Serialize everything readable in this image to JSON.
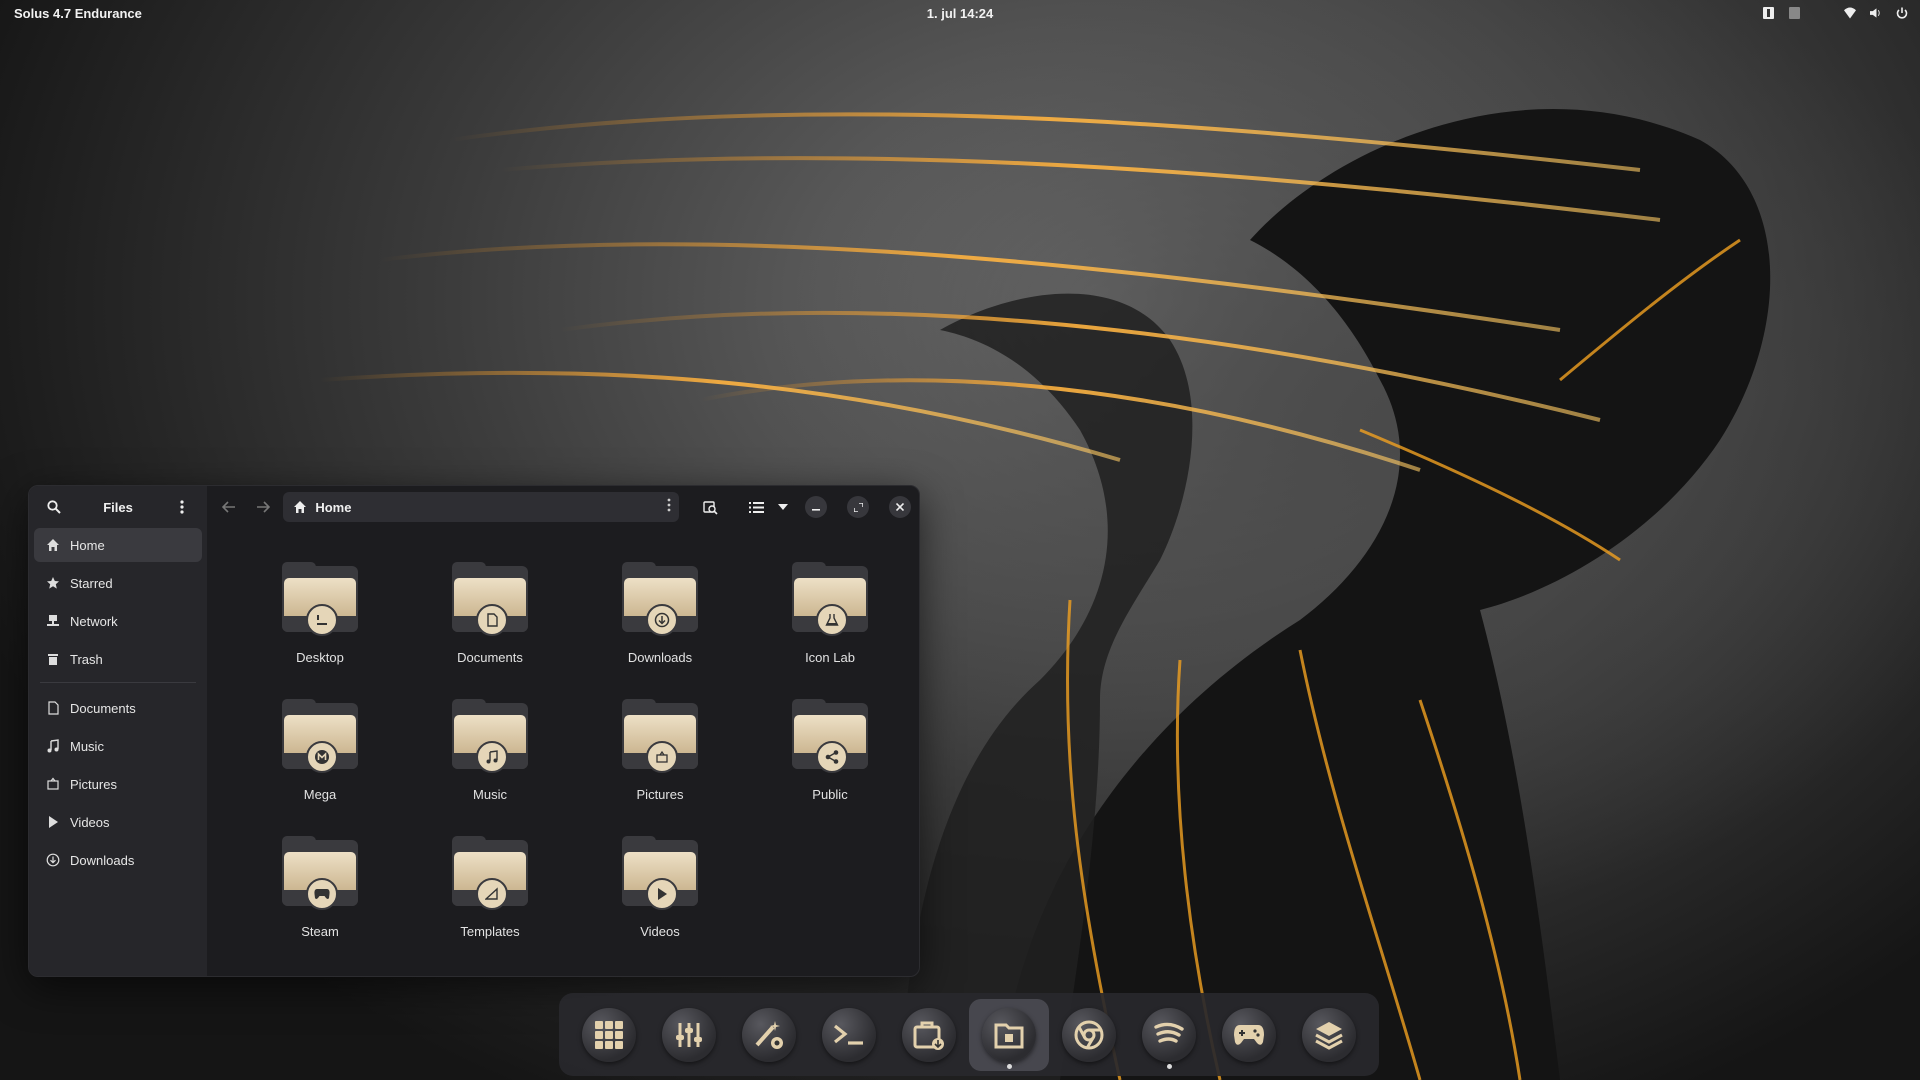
{
  "topbar": {
    "os_label": "Solus 4.7 Endurance",
    "clock": "1. jul  14:24",
    "tray": [
      "keyboard-layout-icon",
      "accessibility-icon",
      "wifi-icon",
      "volume-icon",
      "power-icon"
    ]
  },
  "window": {
    "sidebar_title": "Files",
    "sidebar_places": [
      {
        "label": "Home",
        "icon": "home-icon",
        "active": true
      },
      {
        "label": "Starred",
        "icon": "star-icon"
      },
      {
        "label": "Network",
        "icon": "network-icon"
      },
      {
        "label": "Trash",
        "icon": "trash-icon"
      }
    ],
    "sidebar_bookmarks": [
      {
        "label": "Documents",
        "icon": "document-icon"
      },
      {
        "label": "Music",
        "icon": "music-icon"
      },
      {
        "label": "Pictures",
        "icon": "picture-icon"
      },
      {
        "label": "Videos",
        "icon": "video-icon"
      },
      {
        "label": "Downloads",
        "icon": "download-icon"
      }
    ],
    "path": "Home",
    "folders": [
      {
        "label": "Desktop",
        "emblem": "desktop-icon"
      },
      {
        "label": "Documents",
        "emblem": "document-icon"
      },
      {
        "label": "Downloads",
        "emblem": "download-icon"
      },
      {
        "label": "Icon Lab",
        "emblem": "flask-icon"
      },
      {
        "label": "Mega",
        "emblem": "mega-icon"
      },
      {
        "label": "Music",
        "emblem": "music-icon"
      },
      {
        "label": "Pictures",
        "emblem": "picture-icon"
      },
      {
        "label": "Public",
        "emblem": "share-icon"
      },
      {
        "label": "Steam",
        "emblem": "gamepad-icon"
      },
      {
        "label": "Templates",
        "emblem": "template-icon"
      },
      {
        "label": "Videos",
        "emblem": "video-icon"
      }
    ]
  },
  "dock": [
    {
      "name": "app-grid-icon"
    },
    {
      "name": "mixer-icon"
    },
    {
      "name": "tweaks-icon"
    },
    {
      "name": "terminal-icon"
    },
    {
      "name": "software-center-icon"
    },
    {
      "name": "files-icon",
      "active": true,
      "running": true
    },
    {
      "name": "chrome-icon"
    },
    {
      "name": "spotify-icon",
      "running": true
    },
    {
      "name": "games-icon"
    },
    {
      "name": "stack-icon"
    }
  ],
  "colors": {
    "accent": "#d9c39a",
    "window_bg": "#1c1c1f",
    "sidebar_bg": "#26262a",
    "gold": "#f0a020"
  }
}
